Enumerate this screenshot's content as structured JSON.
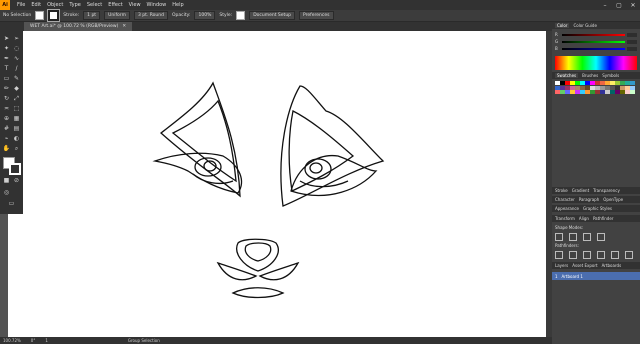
{
  "menubar": {
    "logo": "Ai",
    "items": [
      "File",
      "Edit",
      "Object",
      "Type",
      "Select",
      "Effect",
      "View",
      "Window",
      "Help"
    ],
    "window_controls": [
      "–",
      "▢",
      "✕"
    ]
  },
  "control_bar": {
    "selection": "No Selection",
    "stroke_label": "Stroke:",
    "stroke_value": "1 pt",
    "uniform": "Uniform",
    "brush": "3 pt. Round",
    "opacity_label": "Opacity:",
    "opacity_value": "100%",
    "style_label": "Style:",
    "document_setup": "Document Setup",
    "preferences": "Preferences"
  },
  "doc_tab": {
    "title": "WET Art.ai* @ 100.72 % (RGB/Preview)",
    "close": "✕"
  },
  "statusbar": {
    "zoom": "100.72%",
    "rotation": "0°",
    "artboard": "1",
    "mode": "Group Selection"
  },
  "right_panel": {
    "color_tabs": [
      "Color",
      "Color Guide"
    ],
    "swatch_tabs": [
      "Swatches",
      "Brushes",
      "Symbols"
    ],
    "stroke_tabs": [
      "Stroke",
      "Gradient",
      "Transparency"
    ],
    "char_tabs": [
      "Character",
      "Paragraph",
      "OpenType"
    ],
    "appearance_tabs": [
      "Appearance",
      "Graphic Styles"
    ],
    "transform_tabs": [
      "Transform",
      "Align",
      "Pathfinder"
    ],
    "shape_modes": "Shape Modes:",
    "pathfinders": "Pathfinders:",
    "layers_tabs": [
      "Layers",
      "Asset Export",
      "Artboards"
    ],
    "artboard_row": {
      "num": "1",
      "name": "Artboard 1"
    }
  },
  "colors": {
    "accent": "#ff9a00",
    "selected_layer": "#4b6eaf"
  }
}
